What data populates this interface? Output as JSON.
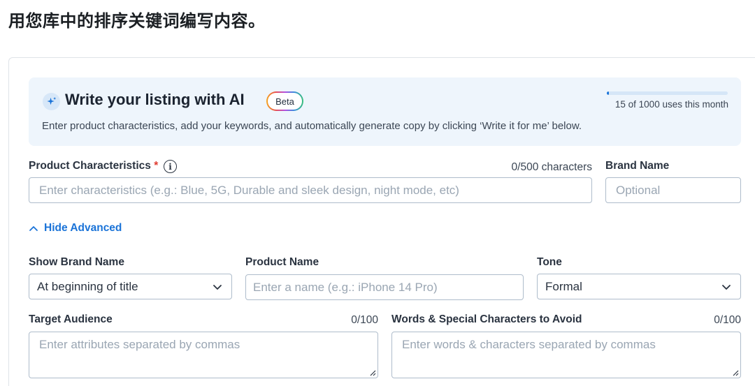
{
  "page": {
    "heading": "用您库中的排序关键词编写内容。"
  },
  "ai_banner": {
    "title": "Write your listing with AI",
    "badge": "Beta",
    "usage_text": "15 of 1000 uses this month",
    "usage_fraction": 0.015,
    "description": "Enter product characteristics, add your keywords, and automatically generate copy by clicking ‘Write it for me’ below.",
    "icon": "sparkle-icon"
  },
  "form": {
    "product_characteristics": {
      "label": "Product Characteristics",
      "required_mark": "*",
      "counter": "0/500 characters",
      "placeholder": "Enter characteristics (e.g.: Blue, 5G, Durable and sleek design, night mode, etc)"
    },
    "brand_name": {
      "label": "Brand Name",
      "placeholder": "Optional"
    },
    "advanced_toggle": {
      "label": "Hide Advanced"
    },
    "show_brand_name": {
      "label": "Show Brand Name",
      "value": "At beginning of title"
    },
    "product_name": {
      "label": "Product Name",
      "placeholder": "Enter a name (e.g.: iPhone 14 Pro)"
    },
    "tone": {
      "label": "Tone",
      "value": "Formal"
    },
    "target_audience": {
      "label": "Target Audience",
      "counter": "0/100",
      "placeholder": "Enter attributes separated by commas"
    },
    "words_to_avoid": {
      "label": "Words & Special Characters to Avoid",
      "counter": "0/100",
      "placeholder": "Enter words & characters separated by commas"
    }
  },
  "colors": {
    "accent": "#1a73d8",
    "banner_bg": "#eef5fc",
    "required": "#e03c31"
  }
}
